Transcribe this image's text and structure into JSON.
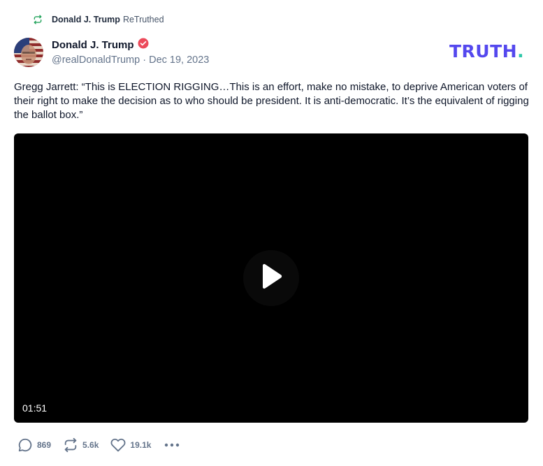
{
  "retruth": {
    "name": "Donald J. Trump",
    "verb": "ReTruthed",
    "icon": "retruth-icon"
  },
  "author": {
    "name": "Donald J. Trump",
    "handle": "@realDonaldTrump",
    "separator": "·",
    "date": "Dec 19, 2023",
    "verified_icon": "verified-badge-icon"
  },
  "brand": {
    "logo_text": "TRUTH",
    "logo_dot": ".",
    "logo_color": "#5448ee",
    "dot_color": "#2ec7a9"
  },
  "post": {
    "text": "Gregg Jarrett: “This is ELECTION RIGGING…This is an effort, make no mistake, to deprive American voters of their right to make the decision as to who should be president. It is anti-democratic. It’s the equivalent of rigging the ballot box.”"
  },
  "video": {
    "duration": "01:51",
    "play_icon": "play-icon"
  },
  "actions": {
    "replies": "869",
    "retruths": "5.6k",
    "likes": "19.1k",
    "reply_icon": "comment-icon",
    "retruth_icon": "retruth-icon",
    "like_icon": "heart-icon",
    "more_icon": "more-icon"
  },
  "colors": {
    "retruth_green": "#22a35b",
    "accent": "#5448ee",
    "verified": "#ec4a5a",
    "muted": "#64748b"
  }
}
